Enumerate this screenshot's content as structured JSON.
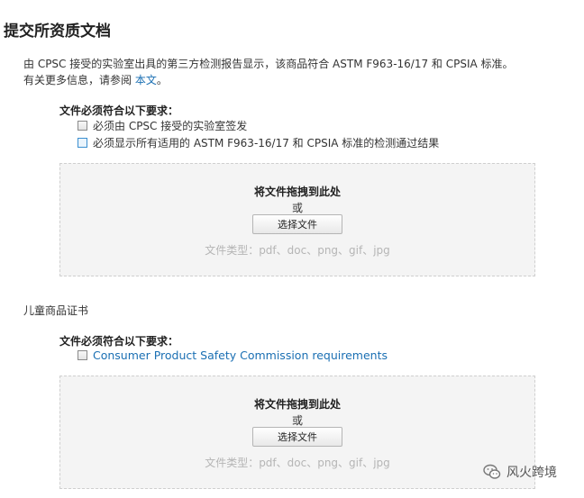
{
  "page_title": "提交所资质文档",
  "intro": {
    "line1": "由 CPSC 接受的实验室出具的第三方检测报告显示，该商品符合 ASTM F963-16/17 和 CPSIA 标准。",
    "line2_prefix": "有关更多信息，请参阅 ",
    "link_text": "本文",
    "line2_suffix": "。"
  },
  "section1": {
    "req_title": "文件必须符合以下要求：",
    "requirements": [
      "必须由 CPSC 接受的实验室签发",
      "必须显示所有适用的 ASTM F963-16/17 和 CPSIA 标准的检测通过结果"
    ],
    "drop": {
      "title": "将文件拖拽到此处",
      "or": "或",
      "button": "选择文件",
      "types": "文件类型：pdf、doc、png、gif、jpg"
    }
  },
  "section2": {
    "label": "儿童商品证书",
    "req_title": "文件必须符合以下要求：",
    "requirements": [
      "Consumer Product Safety Commission requirements"
    ],
    "drop": {
      "title": "将文件拖拽到此处",
      "or": "或",
      "button": "选择文件",
      "types": "文件类型：pdf、doc、png、gif、jpg"
    }
  },
  "watermark": {
    "text": "风火跨境",
    "icon": "wechat-icon"
  },
  "colors": {
    "link": "#1a6fb3",
    "drop_bg": "#f4f4f4",
    "muted": "#b5b5b5"
  }
}
